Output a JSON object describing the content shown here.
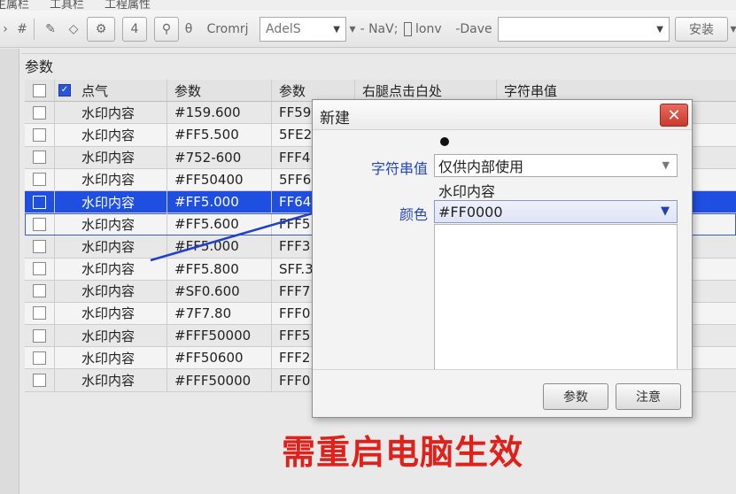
{
  "menubar": {
    "items": [
      "生属栏",
      "工具栏",
      "工程属性"
    ]
  },
  "toolbar": {
    "num_label": "4",
    "theta_label": "θ",
    "text_item": "Cromrj",
    "font_combo": "AdelS",
    "nav_label": "- NaV;",
    "checkbox_label": "lonv",
    "dave_label": "-Dave",
    "search_value": "",
    "action_button": "安装"
  },
  "panel": {
    "title": "参数"
  },
  "table": {
    "headers": [
      "点气",
      "参数",
      "参数",
      "右腿点击白处",
      "字符串值"
    ],
    "rows": [
      {
        "name": "水印内容",
        "param1": "#159.600",
        "param2": "FF59"
      },
      {
        "name": "水印内容",
        "param1": "#FF5.500",
        "param2": "5FE2"
      },
      {
        "name": "水印内容",
        "param1": "#752-600",
        "param2": "FFF4"
      },
      {
        "name": "水印内容",
        "param1": "#FF50400",
        "param2": "5FF6"
      },
      {
        "name": "水印内容",
        "param1": "#FF5.000",
        "param2": "FF64"
      },
      {
        "name": "水印内容",
        "param1": "#FF5.600",
        "param2": "FFF5"
      },
      {
        "name": "水印内容",
        "param1": "#FF5.000",
        "param2": "FFF3"
      },
      {
        "name": "水印内容",
        "param1": "#FF5.800",
        "param2": "SFF.3"
      },
      {
        "name": "水印内容",
        "param1": "#SF0.600",
        "param2": "FFF7"
      },
      {
        "name": "水印内容",
        "param1": "#7F7.80",
        "param2": "FFF0"
      },
      {
        "name": "水印内容",
        "param1": "#FFF50000",
        "param2": "FFF5"
      },
      {
        "name": "水印内容",
        "param1": "#FF50600",
        "param2": "FFF2"
      },
      {
        "name": "水印内容",
        "param1": "#FFF50000",
        "param2": "FFF0"
      }
    ],
    "selected_row_index": 4,
    "outlined_row_index": 5
  },
  "dialog": {
    "title": "新建",
    "string_label": "字符串值",
    "string_value": "仅供内部使用",
    "sub_text": "水印内容",
    "color_label": "颜色",
    "color_value": "#FF0000",
    "ok_button": "参数",
    "cancel_button": "注意"
  },
  "caption": "需重启电脑生效",
  "colors": {
    "selection": "#1f4fe0",
    "label_blue": "#2346c4",
    "caption_red": "#e0201a",
    "close_red": "#d3463a"
  }
}
